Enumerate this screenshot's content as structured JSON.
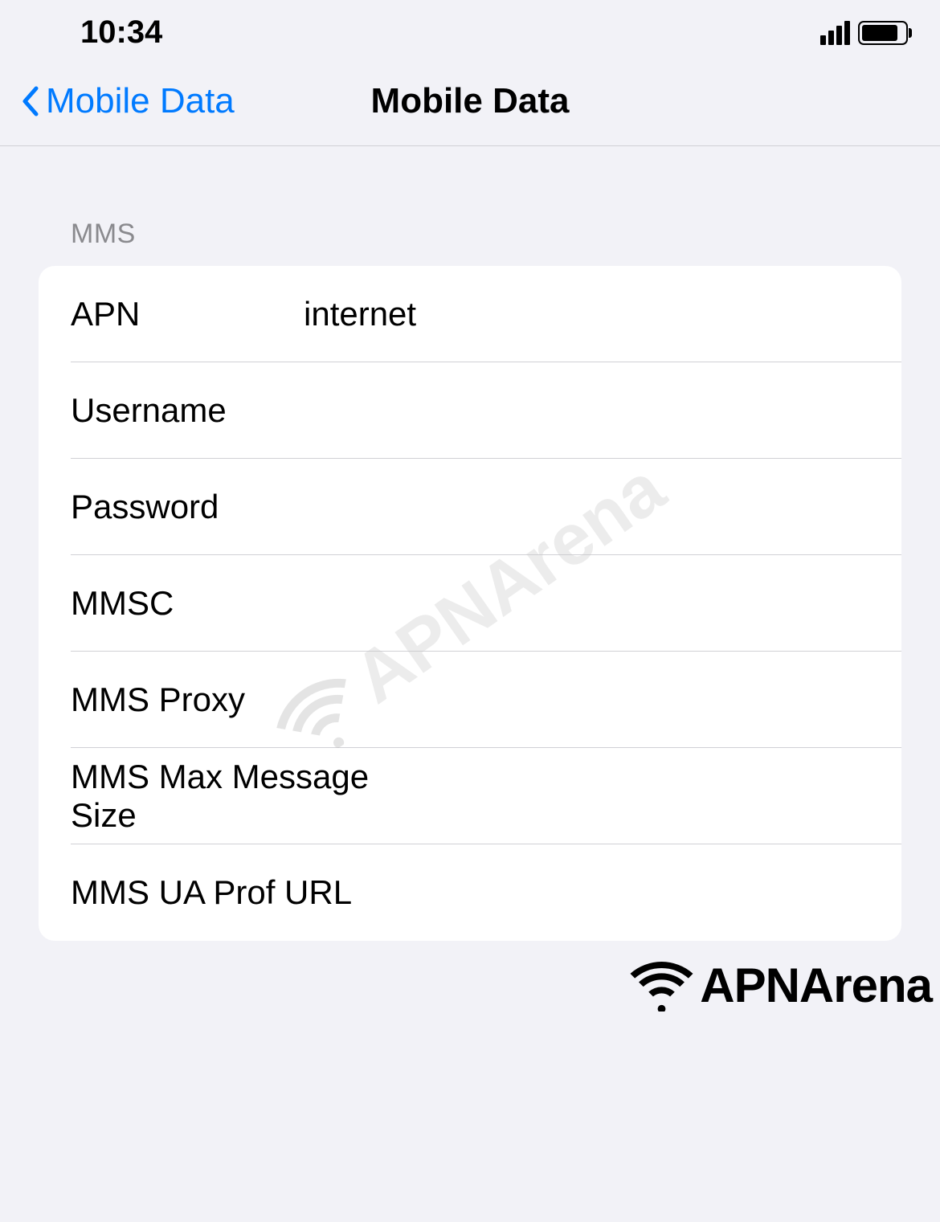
{
  "status_bar": {
    "time": "10:34"
  },
  "nav": {
    "back_label": "Mobile Data",
    "title": "Mobile Data"
  },
  "section": {
    "header": "MMS"
  },
  "fields": {
    "apn": {
      "label": "APN",
      "value": "internet"
    },
    "username": {
      "label": "Username",
      "value": ""
    },
    "password": {
      "label": "Password",
      "value": ""
    },
    "mmsc": {
      "label": "MMSC",
      "value": ""
    },
    "mms_proxy": {
      "label": "MMS Proxy",
      "value": ""
    },
    "mms_max_size": {
      "label": "MMS Max Message Size",
      "value": ""
    },
    "mms_ua_prof": {
      "label": "MMS UA Prof URL",
      "value": ""
    }
  },
  "watermark": {
    "brand": "APNArena"
  }
}
